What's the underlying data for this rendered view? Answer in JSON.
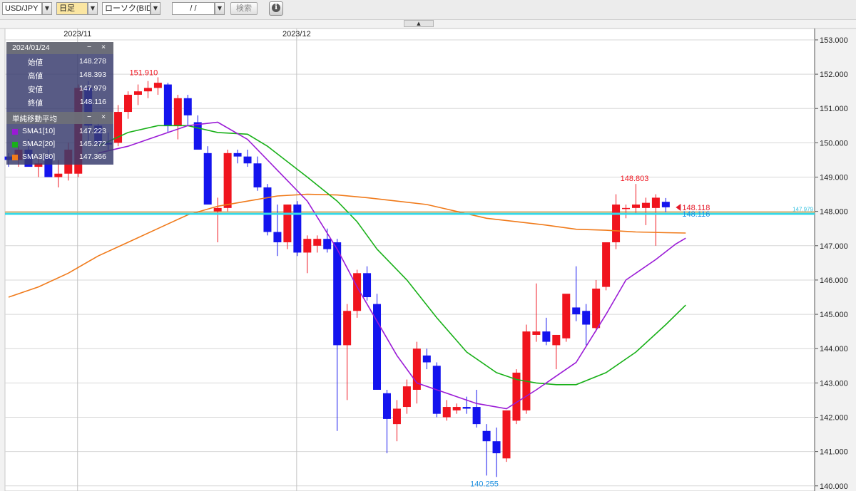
{
  "toolbar": {
    "pair": "USD/JPY",
    "timeframe": "日足",
    "chart_type": "ローソク(BID)",
    "date_value": "/ /",
    "search_label": "検索",
    "info_label": "i",
    "dropdown_glyph": "▼",
    "collapse_glyph": "▲"
  },
  "info_panel": {
    "date": "2024/01/24",
    "minimize": "−",
    "close": "×",
    "rows": [
      {
        "label": "始値",
        "value": "148.278"
      },
      {
        "label": "高値",
        "value": "148.393"
      },
      {
        "label": "安値",
        "value": "147.979"
      },
      {
        "label": "終値",
        "value": "148.116"
      }
    ],
    "ma_title": "単純移動平均",
    "ma_rows": [
      {
        "label": "SMA1[10]",
        "value": "147.223",
        "color": "#9a1ad6"
      },
      {
        "label": "SMA2[20]",
        "value": "145.272",
        "color": "#18b018"
      },
      {
        "label": "SMA3[80]",
        "value": "147.366",
        "color": "#f07a1a"
      }
    ]
  },
  "chart_data": {
    "type": "candlestick",
    "y_range": [
      139.85,
      153.02
    ],
    "y_ticks": [
      "140.000",
      "141.000",
      "142.000",
      "143.000",
      "144.000",
      "145.000",
      "146.000",
      "147.000",
      "148.000",
      "149.000",
      "150.000",
      "151.000",
      "152.000",
      "153.000"
    ],
    "x_labels": [
      {
        "label": "2023/11",
        "index": 7
      },
      {
        "label": "2023/12",
        "index": 29
      }
    ],
    "colors": {
      "up": "#f0141e",
      "down": "#1414ee",
      "sma1": "#9a1ad6",
      "sma2": "#18b018",
      "sma3": "#f07a1a",
      "cursor_line": "#35d8e8",
      "last_price": "#e51a2a",
      "low_price": "#ff8a00",
      "grid": "#d7d7d7"
    },
    "annotations": {
      "high_label": "151.910",
      "recent_high_label": "148.803",
      "low_label": "140.255",
      "last_price": "148.118",
      "cursor_price": "148.116",
      "low_line_label": "147.979"
    },
    "candles": [
      [
        149.6,
        149.7,
        149.3,
        149.5
      ],
      [
        149.5,
        149.9,
        149.3,
        149.8
      ],
      [
        149.8,
        150.1,
        149.5,
        149.3
      ],
      [
        149.3,
        149.6,
        149.0,
        149.4
      ],
      [
        149.6,
        149.8,
        149.2,
        149.0
      ],
      [
        149.0,
        149.5,
        148.7,
        149.1
      ],
      [
        149.1,
        150.0,
        148.9,
        149.8
      ],
      [
        149.1,
        151.7,
        149.0,
        151.6
      ],
      [
        151.6,
        151.8,
        150.0,
        150.5
      ],
      [
        150.5,
        150.8,
        149.9,
        150.0
      ],
      [
        150.0,
        150.3,
        149.8,
        149.95
      ],
      [
        150.0,
        151.1,
        149.9,
        150.9
      ],
      [
        150.9,
        151.5,
        150.7,
        151.4
      ],
      [
        151.4,
        151.7,
        151.1,
        151.5
      ],
      [
        151.5,
        151.8,
        151.3,
        151.6
      ],
      [
        151.6,
        151.91,
        151.4,
        151.75
      ],
      [
        151.7,
        151.75,
        150.3,
        150.5
      ],
      [
        150.5,
        151.4,
        150.1,
        151.3
      ],
      [
        151.3,
        151.4,
        150.5,
        150.8
      ],
      [
        150.6,
        150.8,
        149.8,
        149.8
      ],
      [
        149.7,
        149.9,
        148.2,
        148.2
      ],
      [
        148.0,
        148.4,
        147.1,
        148.1
      ],
      [
        148.1,
        149.8,
        148.0,
        149.7
      ],
      [
        149.7,
        149.8,
        149.4,
        149.6
      ],
      [
        149.6,
        149.8,
        149.3,
        149.4
      ],
      [
        149.4,
        149.6,
        148.6,
        148.7
      ],
      [
        148.7,
        148.8,
        147.3,
        147.4
      ],
      [
        147.4,
        148.2,
        146.7,
        147.1
      ],
      [
        147.1,
        148.2,
        146.9,
        148.2
      ],
      [
        148.2,
        148.3,
        146.7,
        146.8
      ],
      [
        146.8,
        147.3,
        146.2,
        147.2
      ],
      [
        147.0,
        147.3,
        146.8,
        147.2
      ],
      [
        147.2,
        147.5,
        146.8,
        146.9
      ],
      [
        147.1,
        147.2,
        141.6,
        144.1
      ],
      [
        144.1,
        145.3,
        142.5,
        145.1
      ],
      [
        145.1,
        146.3,
        144.9,
        146.2
      ],
      [
        146.2,
        146.4,
        145.4,
        145.5
      ],
      [
        145.3,
        145.6,
        142.8,
        142.8
      ],
      [
        142.7,
        142.8,
        140.95,
        141.95
      ],
      [
        141.8,
        142.5,
        141.3,
        142.25
      ],
      [
        142.3,
        143.1,
        142.1,
        142.9
      ],
      [
        142.8,
        144.2,
        142.4,
        144.0
      ],
      [
        143.8,
        144.0,
        143.4,
        143.6
      ],
      [
        143.5,
        143.6,
        142.0,
        142.1
      ],
      [
        142.0,
        142.5,
        141.9,
        142.3
      ],
      [
        142.2,
        142.4,
        142.1,
        142.3
      ],
      [
        142.3,
        142.6,
        142.1,
        142.25
      ],
      [
        142.3,
        142.8,
        141.7,
        141.8
      ],
      [
        141.6,
        141.8,
        140.3,
        141.3
      ],
      [
        141.3,
        141.7,
        140.26,
        140.95
      ],
      [
        140.8,
        141.9,
        140.7,
        142.2
      ],
      [
        141.9,
        143.4,
        141.8,
        143.3
      ],
      [
        142.2,
        144.7,
        142.1,
        144.5
      ],
      [
        144.4,
        145.9,
        144.2,
        144.5
      ],
      [
        144.5,
        144.9,
        144.1,
        144.2
      ],
      [
        144.1,
        144.4,
        143.4,
        144.4
      ],
      [
        144.3,
        145.2,
        144.2,
        145.6
      ],
      [
        145.2,
        146.4,
        144.8,
        145.0
      ],
      [
        145.1,
        145.3,
        144.1,
        144.7
      ],
      [
        144.6,
        146.0,
        144.5,
        145.75
      ],
      [
        145.8,
        147.1,
        145.7,
        147.1
      ],
      [
        147.1,
        148.5,
        146.9,
        148.2
      ],
      [
        148.1,
        148.2,
        147.8,
        148.1
      ],
      [
        148.1,
        148.8,
        147.9,
        148.2
      ],
      [
        148.1,
        148.4,
        147.6,
        148.25
      ],
      [
        148.1,
        148.5,
        147.0,
        148.4
      ],
      [
        148.28,
        148.39,
        147.98,
        148.12
      ]
    ],
    "sma1": [
      [
        9,
        149.7
      ],
      [
        12,
        149.9
      ],
      [
        15,
        150.2
      ],
      [
        18,
        150.5
      ],
      [
        21,
        150.6
      ],
      [
        24,
        150.1
      ],
      [
        27,
        149.2
      ],
      [
        30,
        148.3
      ],
      [
        33,
        146.9
      ],
      [
        35,
        145.8
      ],
      [
        37,
        144.8
      ],
      [
        39,
        143.8
      ],
      [
        41,
        143.0
      ],
      [
        43,
        142.8
      ],
      [
        45,
        142.6
      ],
      [
        47,
        142.4
      ],
      [
        50,
        142.25
      ],
      [
        53,
        142.8
      ],
      [
        55,
        143.2
      ],
      [
        57,
        143.6
      ],
      [
        60,
        145.0
      ],
      [
        62,
        146.0
      ],
      [
        65,
        146.6
      ],
      [
        67,
        147.05
      ],
      [
        68,
        147.22
      ]
    ],
    "sma2": [
      [
        9,
        149.9
      ],
      [
        12,
        150.3
      ],
      [
        15,
        150.5
      ],
      [
        18,
        150.5
      ],
      [
        21,
        150.3
      ],
      [
        24,
        150.25
      ],
      [
        26,
        149.9
      ],
      [
        30,
        149.0
      ],
      [
        33,
        148.3
      ],
      [
        35,
        147.7
      ],
      [
        37,
        146.9
      ],
      [
        40,
        146.0
      ],
      [
        43,
        144.9
      ],
      [
        46,
        143.9
      ],
      [
        49,
        143.3
      ],
      [
        51,
        143.1
      ],
      [
        53,
        143.0
      ],
      [
        55,
        142.95
      ],
      [
        57,
        142.95
      ],
      [
        60,
        143.3
      ],
      [
        63,
        143.9
      ],
      [
        66,
        144.7
      ],
      [
        68,
        145.27
      ]
    ],
    "sma3": [
      [
        0,
        145.5
      ],
      [
        3,
        145.8
      ],
      [
        6,
        146.2
      ],
      [
        9,
        146.7
      ],
      [
        12,
        147.1
      ],
      [
        15,
        147.5
      ],
      [
        18,
        147.9
      ],
      [
        21,
        148.15
      ],
      [
        24,
        148.3
      ],
      [
        27,
        148.45
      ],
      [
        30,
        148.5
      ],
      [
        33,
        148.48
      ],
      [
        36,
        148.4
      ],
      [
        39,
        148.3
      ],
      [
        42,
        148.2
      ],
      [
        45,
        148.0
      ],
      [
        48,
        147.8
      ],
      [
        51,
        147.7
      ],
      [
        54,
        147.6
      ],
      [
        57,
        147.48
      ],
      [
        60,
        147.45
      ],
      [
        63,
        147.4
      ],
      [
        66,
        147.38
      ],
      [
        68,
        147.37
      ]
    ],
    "markers": {
      "high_index": 15,
      "recent_high_index": 63,
      "low_index": 49
    }
  }
}
